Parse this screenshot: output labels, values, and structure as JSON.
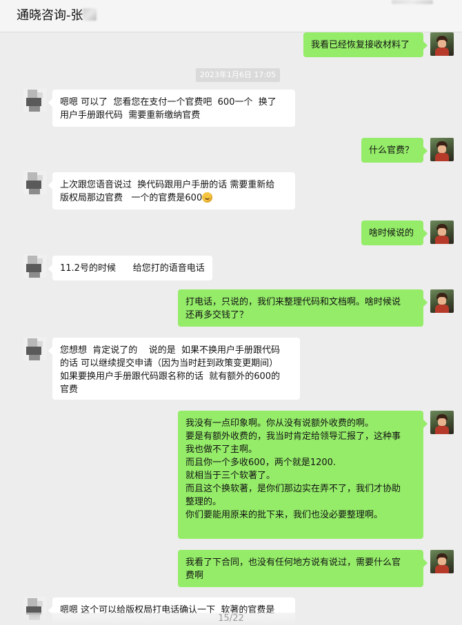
{
  "header": {
    "title": "通晓咨询-张"
  },
  "timestamp": "2023年1月6日 17:05",
  "messages": [
    {
      "dir": "out",
      "text": "我看已经恢复接收材料了"
    },
    {
      "dir": "in",
      "text": "嗯嗯 可以了  您看您在支付一个官费吧  600一个  换了\n用户手册跟代码  需要重新缴纳官费"
    },
    {
      "dir": "out",
      "text": "什么官费？"
    },
    {
      "dir": "in",
      "text": "上次跟您语音说过  换代码跟用户手册的话 需要重新给\n版权局那边官费   一个的官费是600",
      "emoji": "grimace-emoji"
    },
    {
      "dir": "out",
      "text": "啥时候说的"
    },
    {
      "dir": "in",
      "text": "11.2号的时候      给您打的语音电话"
    },
    {
      "dir": "out",
      "text": "打电话，只说的，我们来整理代码和文档啊。啥时候说\n还再多交钱了？"
    },
    {
      "dir": "in",
      "text": "您想想  肯定说了的    说的是  如果不换用户手册跟代码\n的话 可以继续提交申请（因为当时赶到政策变更期间）\n如果要换用户手册跟代码跟名称的话  就有额外的600的\n官费"
    },
    {
      "dir": "out",
      "text": "我没有一点印象啊。你从没有说额外收费的啊。\n要是有额外收费的，我当时肯定给领导汇报了，这种事\n我也做不了主啊。\n而且你一个多收600，两个就是1200.\n就相当于三个软著了。\n而且这个换软著，是你们那边实在弄不了，我们才协助\n整理的。\n你们要能用原来的批下来，我们也没必要整理啊。"
    },
    {
      "dir": "out",
      "text": "我看了下合同，也没有任何地方说有说过，需要什么官\n费啊"
    },
    {
      "dir": "in",
      "text": "嗯嗯 这个可以给版权局打电话确认一下  软著的官费是"
    }
  ],
  "pager": "15/22"
}
